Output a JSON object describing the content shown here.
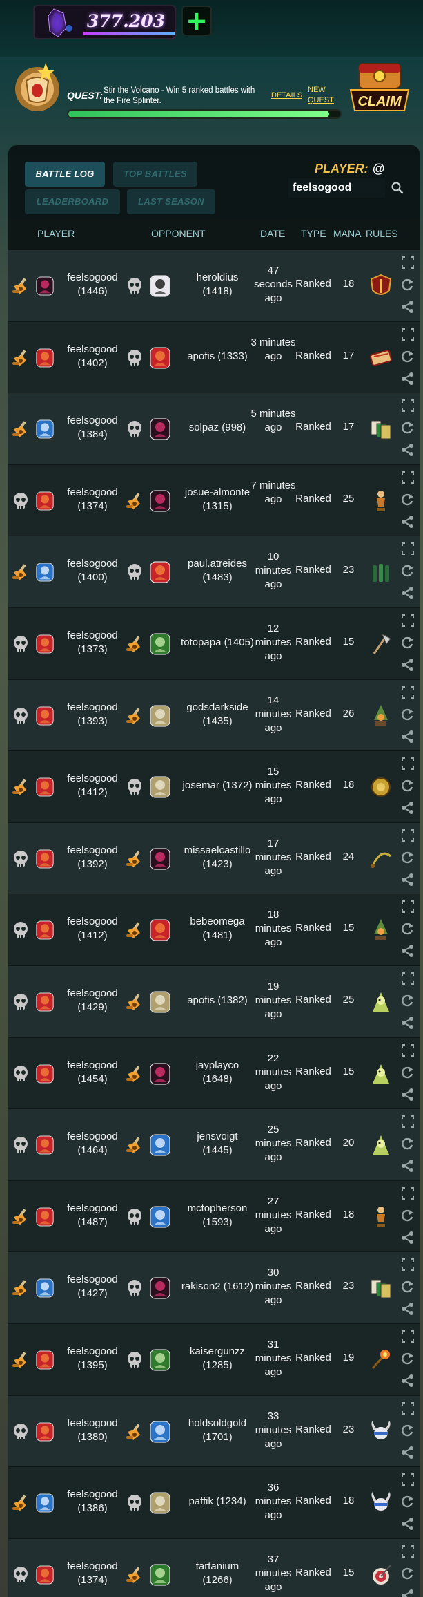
{
  "colors": {
    "accent": "#f5c24b",
    "win": "#f0a030",
    "loss": "#c8c8c8",
    "progress": "#4fe070"
  },
  "balance": {
    "value": "377.203",
    "icon": "dec-crystal-icon",
    "add_icon": "plus-icon"
  },
  "quest": {
    "label": "QUEST:",
    "description": "Stir the Volcano - Win 5 ranked battles with the Fire Splinter.",
    "details_link": "DETAILS",
    "new_quest_link": "NEW QUEST",
    "progress_fraction": 0.96,
    "claim_label": "CLAIM"
  },
  "tabs": [
    {
      "label": "BATTLE LOG",
      "active": true
    },
    {
      "label": "TOP BATTLES",
      "active": false
    },
    {
      "label": "LEADERBOARD",
      "active": false
    },
    {
      "label": "LAST SEASON",
      "active": false
    }
  ],
  "search": {
    "label": "PLAYER:",
    "at": "@",
    "value": "feelsogood"
  },
  "columns": {
    "player": "PLAYER",
    "opponent": "OPPONENT",
    "date": "DATE",
    "type": "TYPE",
    "mana": "MANA",
    "rules": "RULES"
  },
  "battles": [
    {
      "player_result": "win",
      "player_splinter": "death",
      "player_name": "feelsogood",
      "player_rating": "(1446)",
      "opp_result": "loss",
      "opp_splinter": "neutral",
      "opp_name": "heroldius",
      "opp_rating": "(1418)",
      "date": "47 seconds ago",
      "type": "Ranked",
      "mana": "18",
      "rule_icon": "shield-rule-icon"
    },
    {
      "player_result": "win",
      "player_splinter": "fire",
      "player_name": "feelsogood",
      "player_rating": "(1402)",
      "opp_result": "loss",
      "opp_splinter": "fire",
      "opp_name": "apofis",
      "opp_rating": "(1333)",
      "date": "3 minutes ago",
      "type": "Ranked",
      "mana": "17",
      "rule_icon": "scroll-rule-icon"
    },
    {
      "player_result": "win",
      "player_splinter": "water",
      "player_name": "feelsogood",
      "player_rating": "(1384)",
      "opp_result": "loss",
      "opp_splinter": "death",
      "opp_name": "solpaz",
      "opp_rating": "(998)",
      "date": "5 minutes ago",
      "type": "Ranked",
      "mana": "17",
      "rule_icon": "cards-rule-icon"
    },
    {
      "player_result": "loss",
      "player_splinter": "fire",
      "player_name": "feelsogood",
      "player_rating": "(1374)",
      "opp_result": "win",
      "opp_splinter": "death",
      "opp_name": "josue-almonte",
      "opp_rating": "(1315)",
      "date": "7 minutes ago",
      "type": "Ranked",
      "mana": "25",
      "rule_icon": "trophy-rule-icon"
    },
    {
      "player_result": "win",
      "player_splinter": "water",
      "player_name": "feelsogood",
      "player_rating": "(1400)",
      "opp_result": "loss",
      "opp_splinter": "fire",
      "opp_name": "paul.atreides",
      "opp_rating": "(1483)",
      "date": "10 minutes ago",
      "type": "Ranked",
      "mana": "23",
      "rule_icon": "bottles-rule-icon"
    },
    {
      "player_result": "loss",
      "player_splinter": "fire",
      "player_name": "feelsogood",
      "player_rating": "(1373)",
      "opp_result": "win",
      "opp_splinter": "earth",
      "opp_name": "totopapa",
      "opp_rating": "(1405)",
      "date": "12 minutes ago",
      "type": "Ranked",
      "mana": "15",
      "rule_icon": "axe-rule-icon"
    },
    {
      "player_result": "loss",
      "player_splinter": "fire",
      "player_name": "feelsogood",
      "player_rating": "(1393)",
      "opp_result": "win",
      "opp_splinter": "life",
      "opp_name": "godsdarkside",
      "opp_rating": "(1435)",
      "date": "14 minutes ago",
      "type": "Ranked",
      "mana": "26",
      "rule_icon": "lantern-rule-icon"
    },
    {
      "player_result": "win",
      "player_splinter": "fire",
      "player_name": "feelsogood",
      "player_rating": "(1412)",
      "opp_result": "loss",
      "opp_splinter": "life",
      "opp_name": "josemar",
      "opp_rating": "(1372)",
      "date": "15 minutes ago",
      "type": "Ranked",
      "mana": "18",
      "rule_icon": "gong-rule-icon"
    },
    {
      "player_result": "loss",
      "player_splinter": "fire",
      "player_name": "feelsogood",
      "player_rating": "(1392)",
      "opp_result": "win",
      "opp_splinter": "death",
      "opp_name": "missaelcastillo",
      "opp_rating": "(1423)",
      "date": "17 minutes ago",
      "type": "Ranked",
      "mana": "24",
      "rule_icon": "whip-rule-icon"
    },
    {
      "player_result": "loss",
      "player_splinter": "fire",
      "player_name": "feelsogood",
      "player_rating": "(1412)",
      "opp_result": "win",
      "opp_splinter": "fire",
      "opp_name": "bebeomega",
      "opp_rating": "(1481)",
      "date": "18 minutes ago",
      "type": "Ranked",
      "mana": "15",
      "rule_icon": "lantern-rule-icon"
    },
    {
      "player_result": "loss",
      "player_splinter": "fire",
      "player_name": "feelsogood",
      "player_rating": "(1429)",
      "opp_result": "win",
      "opp_splinter": "life",
      "opp_name": "apofis",
      "opp_rating": "(1382)",
      "date": "19 minutes ago",
      "type": "Ranked",
      "mana": "25",
      "rule_icon": "ghost-rule-icon"
    },
    {
      "player_result": "loss",
      "player_splinter": "fire",
      "player_name": "feelsogood",
      "player_rating": "(1454)",
      "opp_result": "win",
      "opp_splinter": "death",
      "opp_name": "jayplayco",
      "opp_rating": "(1648)",
      "date": "22 minutes ago",
      "type": "Ranked",
      "mana": "15",
      "rule_icon": "ghost-rule-icon"
    },
    {
      "player_result": "loss",
      "player_splinter": "fire",
      "player_name": "feelsogood",
      "player_rating": "(1464)",
      "opp_result": "win",
      "opp_splinter": "water",
      "opp_name": "jensvoigt",
      "opp_rating": "(1445)",
      "date": "25 minutes ago",
      "type": "Ranked",
      "mana": "20",
      "rule_icon": "ghost-rule-icon"
    },
    {
      "player_result": "win",
      "player_splinter": "fire",
      "player_name": "feelsogood",
      "player_rating": "(1487)",
      "opp_result": "loss",
      "opp_splinter": "water",
      "opp_name": "mctopherson",
      "opp_rating": "(1593)",
      "date": "27 minutes ago",
      "type": "Ranked",
      "mana": "18",
      "rule_icon": "trophy-rule-icon"
    },
    {
      "player_result": "win",
      "player_splinter": "water",
      "player_name": "feelsogood",
      "player_rating": "(1427)",
      "opp_result": "loss",
      "opp_splinter": "death",
      "opp_name": "rakison2",
      "opp_rating": "(1612)",
      "date": "30 minutes ago",
      "type": "Ranked",
      "mana": "23",
      "rule_icon": "cards-rule-icon"
    },
    {
      "player_result": "win",
      "player_splinter": "fire",
      "player_name": "feelsogood",
      "player_rating": "(1395)",
      "opp_result": "loss",
      "opp_splinter": "earth",
      "opp_name": "kaisergunzz",
      "opp_rating": "(1285)",
      "date": "31 minutes ago",
      "type": "Ranked",
      "mana": "19",
      "rule_icon": "spark-rule-icon"
    },
    {
      "player_result": "loss",
      "player_splinter": "fire",
      "player_name": "feelsogood",
      "player_rating": "(1380)",
      "opp_result": "win",
      "opp_splinter": "water",
      "opp_name": "holdsoldgold",
      "opp_rating": "(1701)",
      "date": "33 minutes ago",
      "type": "Ranked",
      "mana": "23",
      "rule_icon": "viking-rule-icon"
    },
    {
      "player_result": "win",
      "player_splinter": "water",
      "player_name": "feelsogood",
      "player_rating": "(1386)",
      "opp_result": "loss",
      "opp_splinter": "life",
      "opp_name": "paffik",
      "opp_rating": "(1234)",
      "date": "36 minutes ago",
      "type": "Ranked",
      "mana": "18",
      "rule_icon": "viking-rule-icon"
    },
    {
      "player_result": "loss",
      "player_splinter": "fire",
      "player_name": "feelsogood",
      "player_rating": "(1374)",
      "opp_result": "win",
      "opp_splinter": "earth",
      "opp_name": "tartanium",
      "opp_rating": "(1266)",
      "date": "37 minutes ago",
      "type": "Ranked",
      "mana": "15",
      "rule_icon": "target-rule-icon"
    }
  ]
}
